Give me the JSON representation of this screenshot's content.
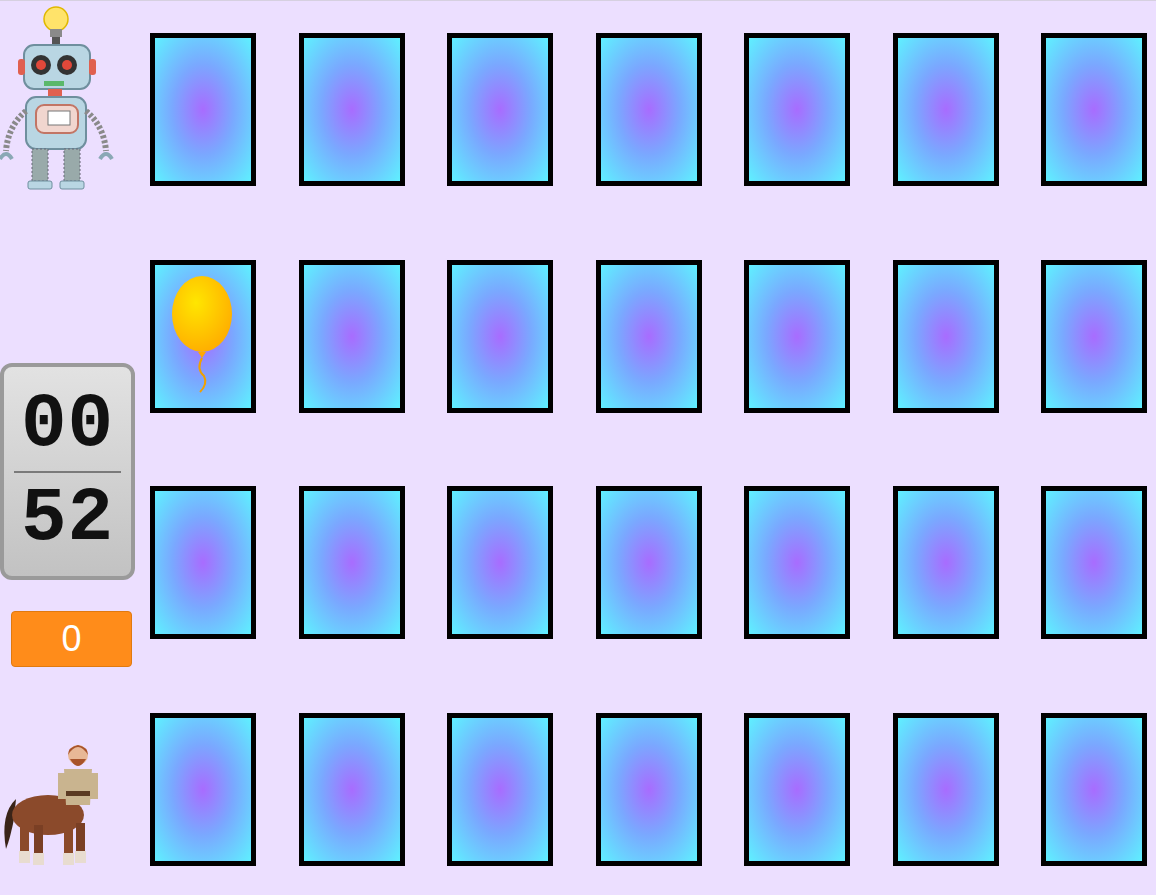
{
  "players": [
    {
      "thinking": true
    },
    {
      "thinking": false
    }
  ],
  "timer": {
    "top": "00",
    "bottom": "52"
  },
  "score": "0",
  "cards": [
    {
      "face_up": false
    },
    {
      "face_up": false
    },
    {
      "face_up": false
    },
    {
      "face_up": false
    },
    {
      "face_up": false
    },
    {
      "face_up": false
    },
    {
      "face_up": false
    },
    {
      "face_up": true
    },
    {
      "face_up": false
    },
    {
      "face_up": false
    },
    {
      "face_up": false
    },
    {
      "face_up": false
    },
    {
      "face_up": false
    },
    {
      "face_up": false
    },
    {
      "face_up": false
    },
    {
      "face_up": false
    },
    {
      "face_up": false
    },
    {
      "face_up": false
    },
    {
      "face_up": false
    },
    {
      "face_up": false
    },
    {
      "face_up": false
    },
    {
      "face_up": false
    },
    {
      "face_up": false
    },
    {
      "face_up": false
    },
    {
      "face_up": false
    },
    {
      "face_up": false
    },
    {
      "face_up": false
    },
    {
      "face_up": false
    }
  ]
}
